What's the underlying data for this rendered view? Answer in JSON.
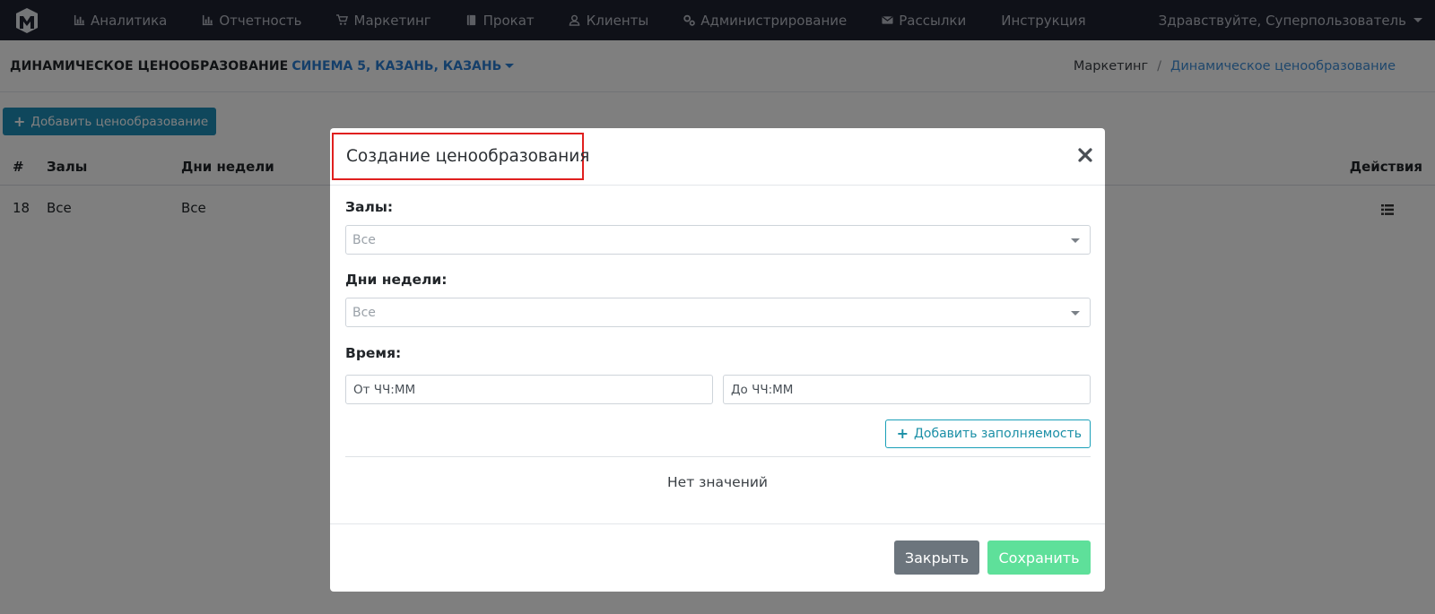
{
  "navbar": {
    "items": [
      {
        "label": "Аналитика",
        "icon": "bar-chart-icon"
      },
      {
        "label": "Отчетность",
        "icon": "bar-chart-icon"
      },
      {
        "label": "Маркетинг",
        "icon": "cart-icon"
      },
      {
        "label": "Прокат",
        "icon": "book-icon"
      },
      {
        "label": "Клиенты",
        "icon": "user-icon"
      },
      {
        "label": "Администрирование",
        "icon": "gears-icon"
      },
      {
        "label": "Рассылки",
        "icon": "envelope-icon"
      },
      {
        "label": "Инструкция",
        "icon": ""
      }
    ],
    "user_greeting": "Здравствуйте, Суперпользователь"
  },
  "header": {
    "title": "ДИНАМИЧЕСКОЕ ЦЕНООБРАЗОВАНИЕ",
    "cinema": "СИНЕМА 5, КАЗАНЬ, КАЗАНЬ",
    "breadcrumb": [
      "Маркетинг",
      "/",
      "Динамическое ценообразование"
    ]
  },
  "main": {
    "add_button": "Добавить ценообразование",
    "table": {
      "columns": [
        "#",
        "Залы",
        "Дни недели",
        "Действия"
      ],
      "rows": [
        {
          "id": "18",
          "halls": "Все",
          "days": "Все"
        }
      ]
    }
  },
  "modal": {
    "title": "Создание ценообразования",
    "halls_label": "Залы:",
    "halls_value": "Все",
    "days_label": "Дни недели:",
    "days_value": "Все",
    "time_label": "Время:",
    "time_from_placeholder": "От ЧЧ:ММ",
    "time_to_placeholder": "До ЧЧ:ММ",
    "add_occupancy_button": "Добавить заполняемость",
    "empty_text": "Нет значений",
    "close_button": "Закрыть",
    "save_button": "Сохранить"
  },
  "colors": {
    "navbar_bg": "#1f2330",
    "accent_blue": "#2a7fd4",
    "add_button": "#1f8fb9",
    "save_button": "#5ee09a",
    "close_button": "#6c757d",
    "highlight_border": "#e0201f"
  }
}
